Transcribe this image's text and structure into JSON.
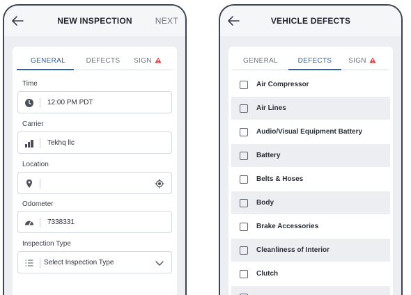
{
  "screen1": {
    "title": "NEW INSPECTION",
    "next_label": "NEXT",
    "tabs": [
      {
        "label": "GENERAL",
        "active": true
      },
      {
        "label": "DEFECTS",
        "active": false
      },
      {
        "label": "SIGN",
        "active": false,
        "warning": true
      }
    ],
    "fields": {
      "time": {
        "label": "Time",
        "value": "12:00 PM PDT",
        "icon": "clock-icon"
      },
      "carrier": {
        "label": "Carrier",
        "value": "Tekhq llc",
        "icon": "building-icon"
      },
      "location": {
        "label": "Location",
        "value": "",
        "icon": "location-pin-icon",
        "right_icon": "gps-target-icon"
      },
      "odometer": {
        "label": "Odometer",
        "value": "7338331",
        "icon": "speedometer-icon"
      },
      "inspection_type": {
        "label": "Inspection Type",
        "value": "Select Inspection Type",
        "icon": "list-icon",
        "right_icon": "chevron-down-icon"
      }
    }
  },
  "screen2": {
    "title": "VEHICLE DEFECTS",
    "tabs": [
      {
        "label": "GENERAL",
        "active": false
      },
      {
        "label": "DEFECTS",
        "active": true
      },
      {
        "label": "SIGN",
        "active": false,
        "warning": true
      }
    ],
    "defects": [
      "Air Compressor",
      "Air Lines",
      "Audio/Visual Equipment Battery",
      "Battery",
      "Belts & Hoses",
      "Body",
      "Brake Accessories",
      "Cleanliness of Interior",
      "Clutch"
    ]
  },
  "colors": {
    "accent": "#2f5fa8",
    "warning": "#d93b3b",
    "background": "#eceef2"
  }
}
